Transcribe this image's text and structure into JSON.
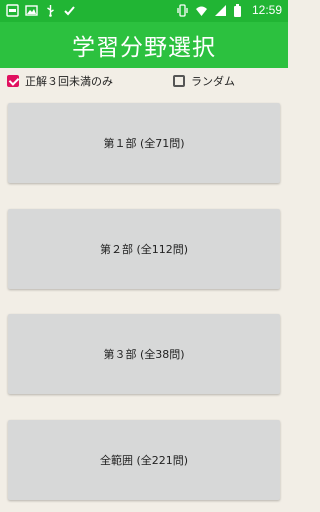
{
  "status_bar": {
    "time": "12:59",
    "left_icons": [
      "notification-icon",
      "image-icon",
      "usb-icon",
      "check-icon"
    ],
    "right_icons": [
      "vibrate-icon",
      "wifi-icon",
      "signal-icon",
      "battery-icon"
    ]
  },
  "app_bar": {
    "title": "学習分野選択"
  },
  "options": {
    "correct_under3": {
      "label": "正解３回未満のみ",
      "checked": true
    },
    "random": {
      "label": "ランダム",
      "checked": false
    }
  },
  "sections": [
    {
      "label": "第１部 (全71問)"
    },
    {
      "label": "第２部 (全112問)"
    },
    {
      "label": "第３部 (全38問)"
    },
    {
      "label": "全範囲 (全221問)"
    }
  ],
  "colors": {
    "status_bar": "#21b534",
    "app_bar": "#2cc13f",
    "checkbox_accent": "#e0115f"
  }
}
